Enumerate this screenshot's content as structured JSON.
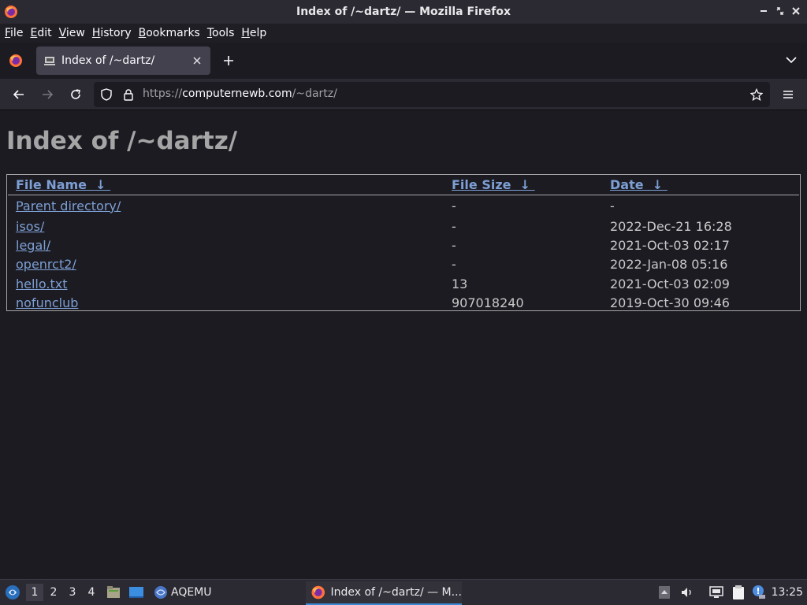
{
  "window": {
    "title": "Index of /~dartz/ — Mozilla Firefox"
  },
  "menubar": {
    "items": [
      {
        "label": "File",
        "u": "F",
        "rest": "ile"
      },
      {
        "label": "Edit",
        "u": "E",
        "rest": "dit"
      },
      {
        "label": "View",
        "u": "V",
        "rest": "iew"
      },
      {
        "label": "History",
        "u": "H",
        "rest": "istory"
      },
      {
        "label": "Bookmarks",
        "u": "B",
        "rest": "ookmarks"
      },
      {
        "label": "Tools",
        "u": "T",
        "rest": "ools"
      },
      {
        "label": "Help",
        "u": "H",
        "rest": "elp"
      }
    ]
  },
  "tabs": [
    {
      "label": "Index of /~dartz/"
    }
  ],
  "urlbar": {
    "prefix": "https://",
    "host": "computernewb.com",
    "path": "/~dartz/"
  },
  "page": {
    "heading": "Index of /~dartz/",
    "columns": [
      {
        "label": "File Name",
        "sort": "↓"
      },
      {
        "label": "File Size",
        "sort": "↓"
      },
      {
        "label": "Date",
        "sort": "↓"
      }
    ],
    "rows": [
      {
        "name": "Parent directory/",
        "size": "-",
        "date": "-"
      },
      {
        "name": "isos/",
        "size": "-",
        "date": "2022-Dec-21 16:28"
      },
      {
        "name": "legal/",
        "size": "-",
        "date": "2021-Oct-03 02:17"
      },
      {
        "name": "openrct2/",
        "size": "-",
        "date": "2022-Jan-08 05:16"
      },
      {
        "name": "hello.txt",
        "size": "13",
        "date": "2021-Oct-03 02:09"
      },
      {
        "name": "nofunclub",
        "size": "907018240",
        "date": "2019-Oct-30 09:46"
      }
    ]
  },
  "taskbar": {
    "workspaces": [
      "1",
      "2",
      "3",
      "4"
    ],
    "launcher_label": "AQEMU",
    "window_label": "Index of /~dartz/ — M...",
    "clock": "13:25"
  },
  "colors": {
    "link": "#7d9fd4",
    "accent": "#3c8ad6"
  }
}
